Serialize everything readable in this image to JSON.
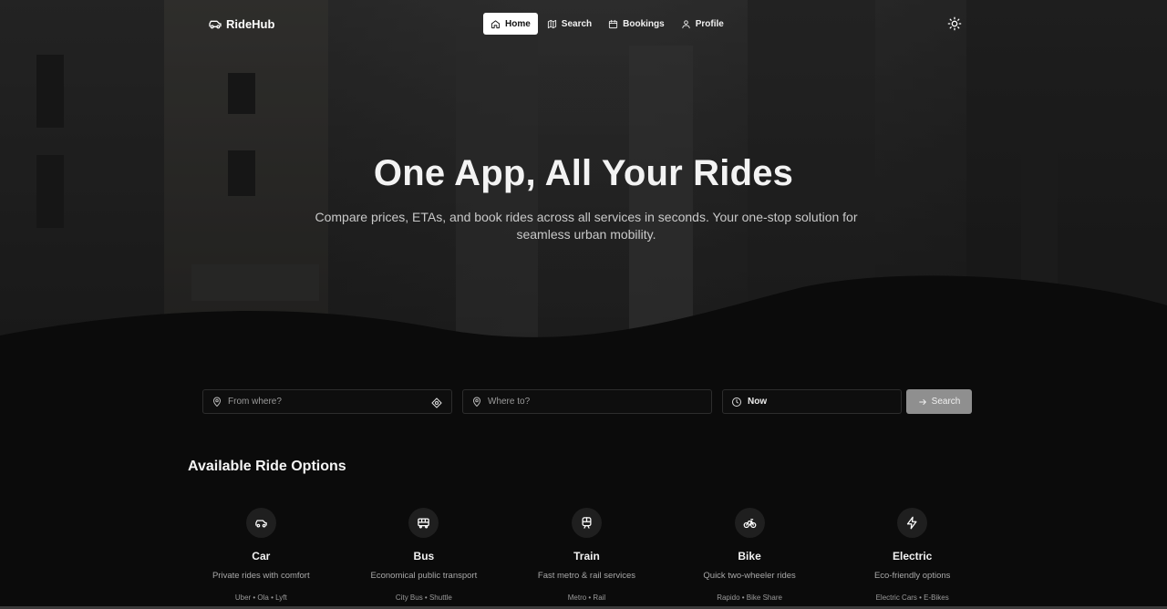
{
  "brand": {
    "name": "RideHub",
    "icon": "car-icon"
  },
  "nav": {
    "items": [
      {
        "label": "Home",
        "icon": "home-icon",
        "active": true
      },
      {
        "label": "Search",
        "icon": "map-icon",
        "active": false
      },
      {
        "label": "Bookings",
        "icon": "calendar-icon",
        "active": false
      },
      {
        "label": "Profile",
        "icon": "user-icon",
        "active": false
      }
    ],
    "theme_icon": "sun-icon"
  },
  "hero": {
    "title": "One App, All Your Rides",
    "subtitle": "Compare prices, ETAs, and book rides across all services in seconds. Your one-stop solution for seamless urban mobility."
  },
  "search": {
    "from_placeholder": "From where?",
    "to_placeholder": "Where to?",
    "when_value": "Now",
    "button_label": "Search"
  },
  "options": {
    "title": "Available Ride Options",
    "items": [
      {
        "name": "Car",
        "desc": "Private rides with comfort",
        "providers": "Uber • Ola • Lyft",
        "icon": "car-icon"
      },
      {
        "name": "Bus",
        "desc": "Economical public transport",
        "providers": "City Bus • Shuttle",
        "icon": "bus-icon"
      },
      {
        "name": "Train",
        "desc": "Fast metro & rail services",
        "providers": "Metro • Rail",
        "icon": "train-icon"
      },
      {
        "name": "Bike",
        "desc": "Quick two-wheeler rides",
        "providers": "Rapido • Bike Share",
        "icon": "bike-icon"
      },
      {
        "name": "Electric",
        "desc": "Eco-friendly options",
        "providers": "Electric Cars • E-Bikes",
        "icon": "bolt-icon"
      }
    ]
  },
  "colors": {
    "background": "#0b0b0b",
    "accent": "#ffffff",
    "button": "#8f8f8f"
  }
}
